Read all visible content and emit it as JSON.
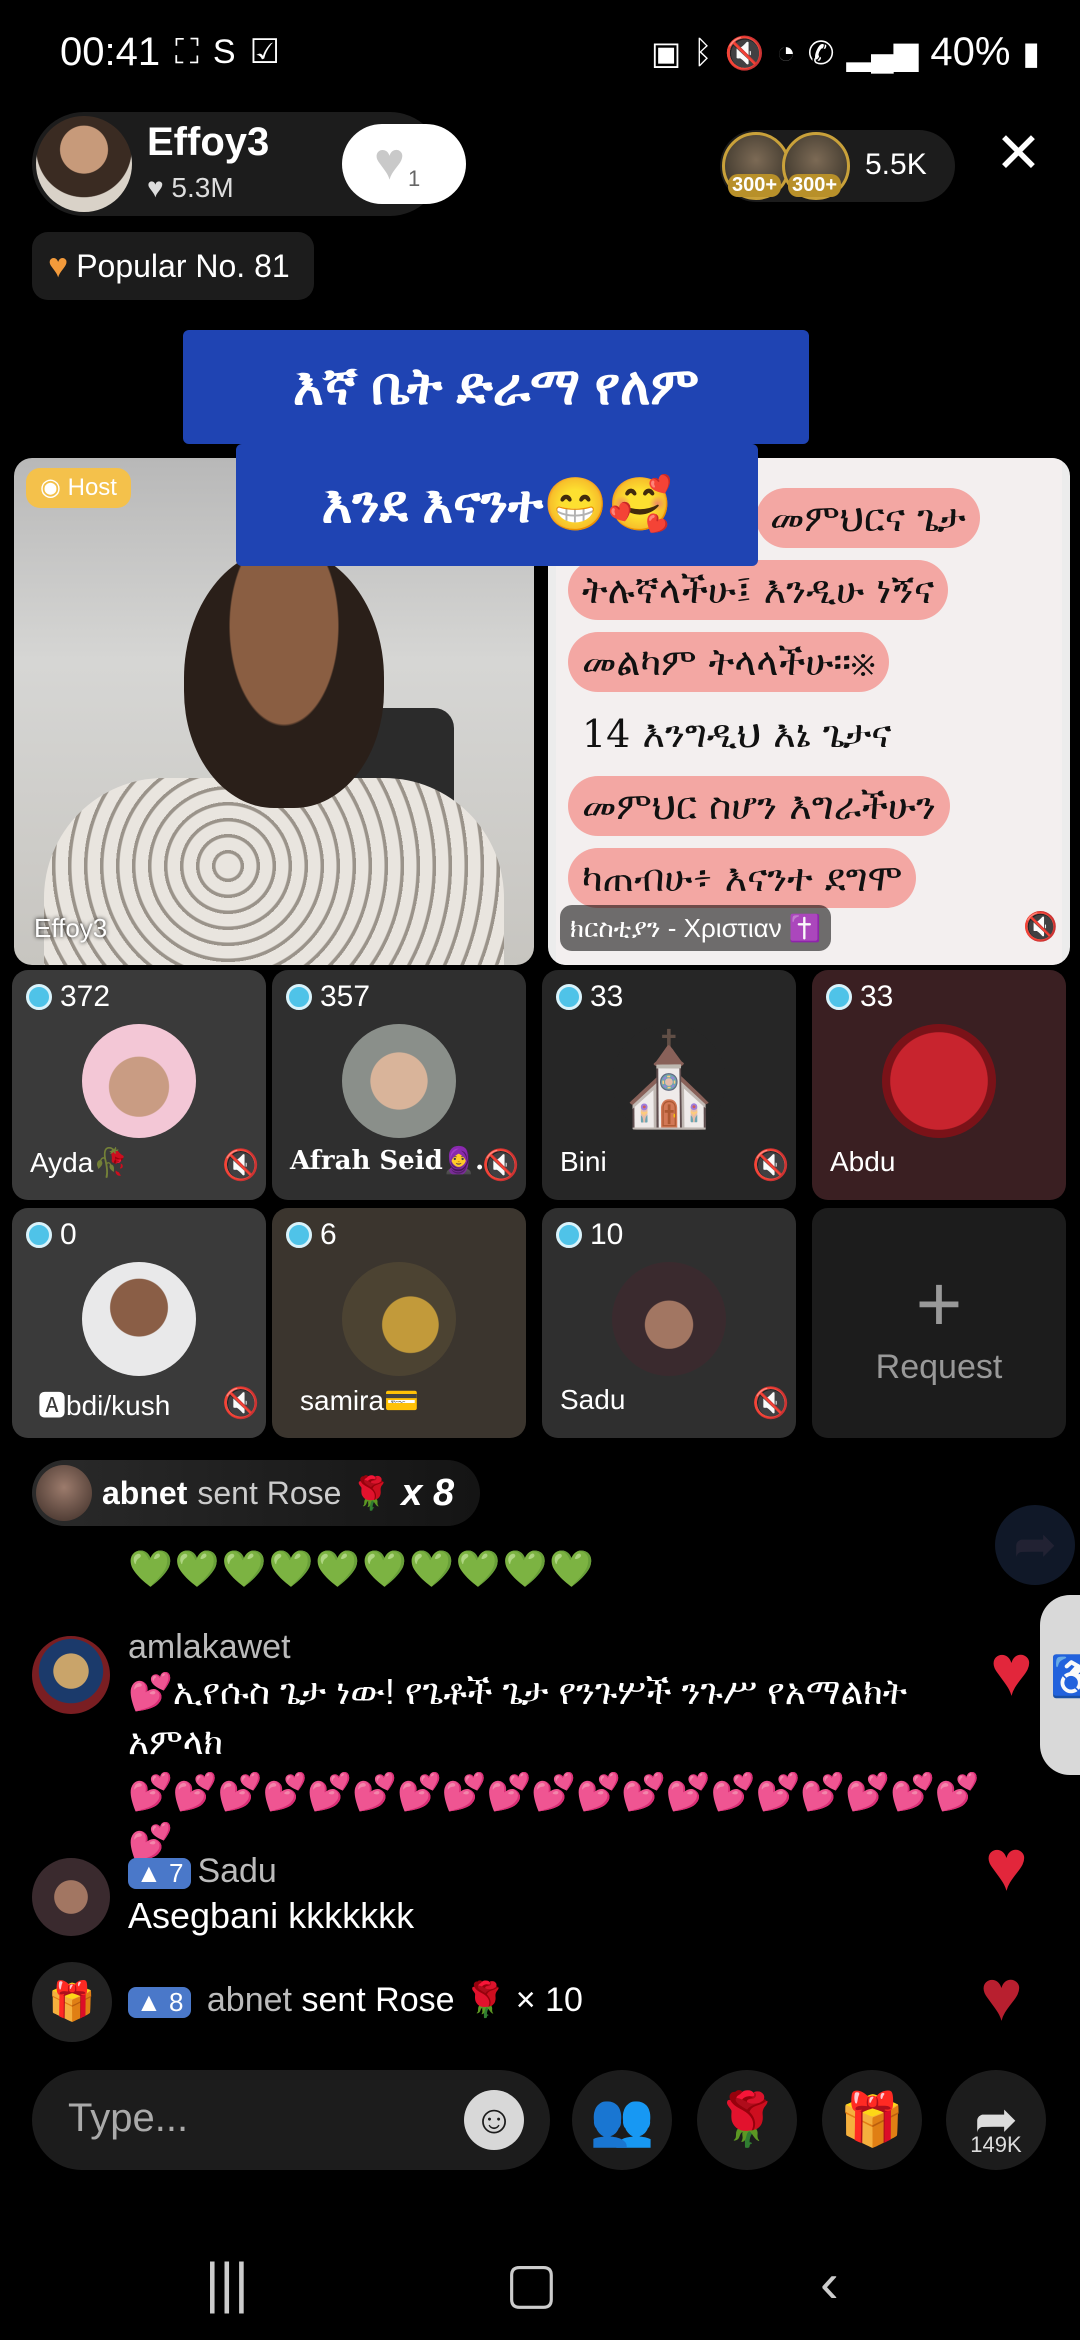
{
  "status_bar": {
    "time": "00:41",
    "battery": "40%",
    "left_icons": [
      "screenshot-icon",
      "s-icon",
      "check-icon"
    ],
    "right_icons": [
      "nfc-icon",
      "bluetooth-icon",
      "mute-icon",
      "wifi-icon",
      "call-icon",
      "signal-icon",
      "battery-icon"
    ]
  },
  "host": {
    "name": "Effoy3",
    "likes": "5.3M",
    "follow_count": "1"
  },
  "viewers": {
    "badges": [
      "300+",
      "300+"
    ],
    "count": "5.5K"
  },
  "popular": {
    "label": "Popular No. 81"
  },
  "banner": {
    "line1": "እኛ ቤት ድራማ የለም",
    "line2": "እንደ እናንተ😁🥰"
  },
  "tiles": {
    "host_tag": "Host",
    "host_label": "Effoy3",
    "scripture_label": "ክርስቲያን - Χριστιαν ✝️",
    "scripture_lines": [
      "መምህርና ጌታ",
      "ትሉኛላችሁ፤ እንዲሁ ነኝና",
      "መልካም ትላላችሁ።※",
      "14 እንግዲህ እኔ ጌታና",
      "መምህር ስሆን እግራችሁን",
      "ካጠብሁ፥ እናንተ ደግሞ"
    ]
  },
  "seats": [
    {
      "count": "372",
      "name": "Ayda🥀",
      "muted": true
    },
    {
      "count": "357",
      "name": "Afrah Seid🧕...",
      "muted": true
    },
    {
      "count": "33",
      "name": "Bini",
      "muted": true
    },
    {
      "count": "33",
      "name": "Abdu",
      "muted": false
    },
    {
      "count": "0",
      "name": "🅰bdi/kush",
      "muted": true
    },
    {
      "count": "6",
      "name": "samira💳",
      "muted": false
    },
    {
      "count": "10",
      "name": "Sadu",
      "muted": true
    }
  ],
  "request": {
    "plus": "+",
    "label": "Request"
  },
  "gift_banner": {
    "user": "abnet",
    "action": "sent Rose",
    "emoji": "🌹",
    "multiplier": "x 8"
  },
  "chat": {
    "hearts": "💚💚💚💚💚💚💚💚💚💚",
    "messages": [
      {
        "user": "amlakawet",
        "text": "💕ኢየሱስ ጌታ ነው! የጌቶች ጌታ የንጉሦች ንጉሥ የአማልክት አምላክ",
        "tail": "💕💕💕💕💕💕💕💕💕💕💕💕💕💕💕💕💕💕💕💕"
      },
      {
        "level": "7",
        "user": "Sadu",
        "text": "Asegbani kkkkkkk"
      }
    ],
    "gift_event": {
      "level": "8",
      "user": "abnet",
      "action": "sent Rose",
      "emoji": "🌹",
      "multiplier": "× 10"
    }
  },
  "bottom_bar": {
    "input_placeholder": "Type...",
    "share_count": "149K"
  },
  "colors": {
    "banner_blue": "#1f44b3",
    "like_red": "#e2263b",
    "host_tag_yellow": "#f4c14b",
    "scripture_highlight": "#f3a7a3",
    "pink": "#ff3ea5"
  }
}
